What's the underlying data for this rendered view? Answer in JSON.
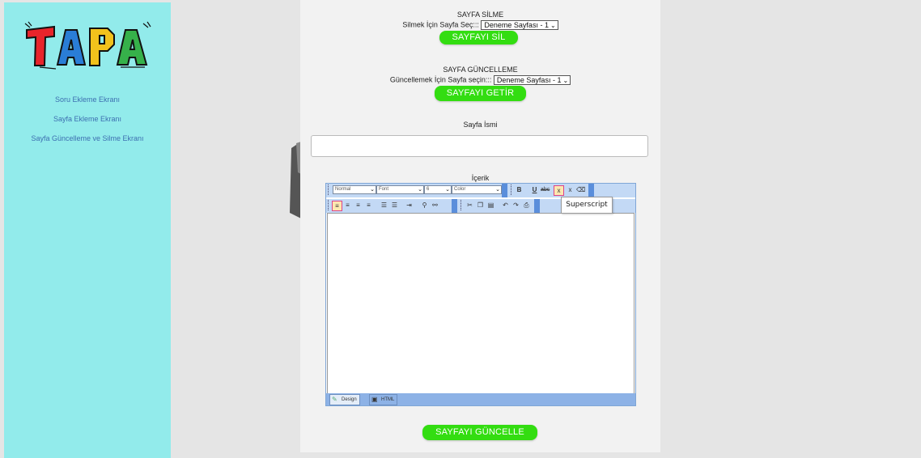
{
  "sidebar": {
    "logo_text": "TAPA",
    "items": [
      {
        "label": "Soru Ekleme Ekranı"
      },
      {
        "label": "Sayfa Ekleme Ekranı"
      },
      {
        "label": "Sayfa Güncelleme ve Silme Ekranı"
      }
    ]
  },
  "delete_section": {
    "title": "SAYFA SİLME",
    "prompt": "Silmek İçin Sayfa Seç:::",
    "selected": "Deneme Sayfası - 1",
    "button": "SAYFAYI SİL"
  },
  "update_section": {
    "title": "SAYFA GÜNCELLEME",
    "prompt": "Güncellemek İçin Sayfa seçin:::",
    "selected": "Deneme Sayfası - 1",
    "button": "SAYFAYI GETİR"
  },
  "page_name": {
    "label": "Sayfa İsmi",
    "value": ""
  },
  "content": {
    "label": "İçerik",
    "toolbar": {
      "paragraph": "Normal",
      "font": "Font",
      "size": "6",
      "color": "Color"
    },
    "tabs": [
      {
        "label": "Design"
      },
      {
        "label": "HTML"
      }
    ],
    "tooltip": "Superscript"
  },
  "update_button": "SAYFAYI GÜNCELLE",
  "colors": {
    "sidebar_bg": "#92ebeb",
    "button_green": "#33dd11",
    "link": "#3d6fb0"
  }
}
